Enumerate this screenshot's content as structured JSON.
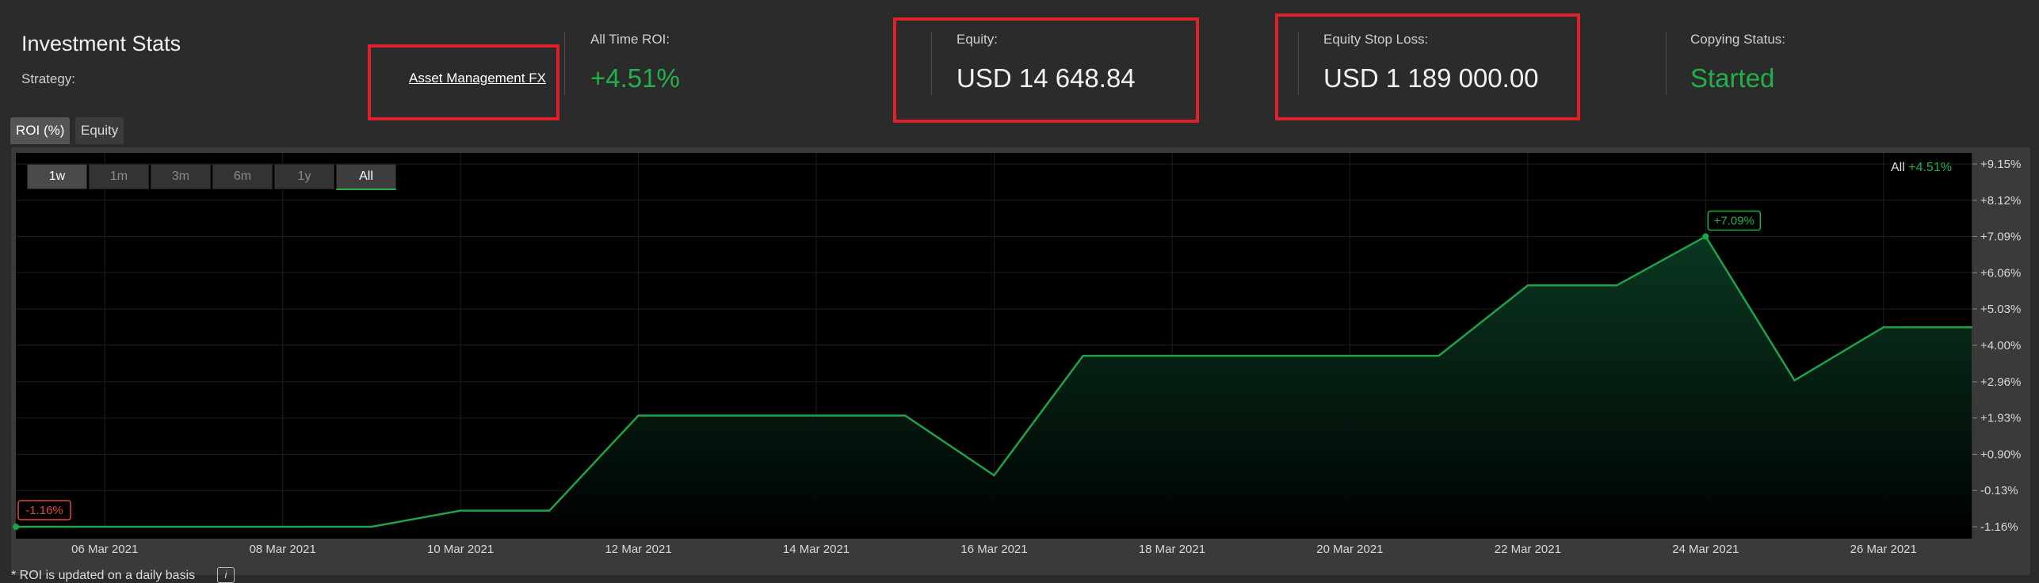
{
  "header": {
    "title": "Investment Stats",
    "strategy_label": "Strategy:",
    "strategy_link": "Asset Management FX"
  },
  "stats": {
    "roi_label": "All Time ROI:",
    "roi_value": "+4.51%",
    "equity_label": "Equity:",
    "equity_value": "USD 14 648.84",
    "stoploss_label": "Equity Stop Loss:",
    "stoploss_value": "USD 1 189 000.00",
    "copying_label": "Copying Status:",
    "copying_value": "Started"
  },
  "tabs": [
    {
      "label": "ROI (%)",
      "active": true
    },
    {
      "label": "Equity",
      "active": false
    }
  ],
  "periods": [
    {
      "label": "1w"
    },
    {
      "label": "1m"
    },
    {
      "label": "3m"
    },
    {
      "label": "6m"
    },
    {
      "label": "1y"
    },
    {
      "label": "All"
    }
  ],
  "legend": {
    "prefix": "All",
    "value": "+4.51%"
  },
  "footnote": "* ROI is updated on a daily basis",
  "info_icon": "i",
  "colors": {
    "accent_green": "#22b04b",
    "negative_red": "#e04a3a",
    "highlight_box": "#e0202a"
  },
  "chart_data": {
    "type": "area",
    "x_ticks": [
      "06 Mar 2021",
      "08 Mar 2021",
      "10 Mar 2021",
      "12 Mar 2021",
      "14 Mar 2021",
      "16 Mar 2021",
      "18 Mar 2021",
      "20 Mar 2021",
      "22 Mar 2021",
      "24 Mar 2021",
      "26 Mar 2021"
    ],
    "y_ticks": [
      "+9.15%",
      "+8.12%",
      "+7.09%",
      "+6.06%",
      "+5.03%",
      "+4.00%",
      "+2.96%",
      "+1.93%",
      "+0.90%",
      "-0.13%",
      "-1.16%"
    ],
    "ylim": [
      -1.16,
      9.15
    ],
    "x_range": [
      "05 Mar 2021",
      "27 Mar 2021"
    ],
    "points": [
      [
        "05 Mar 2021",
        -1.16
      ],
      [
        "09 Mar 2021",
        -1.16
      ],
      [
        "10 Mar 2021",
        -0.7
      ],
      [
        "11 Mar 2021",
        -0.7
      ],
      [
        "12 Mar 2021",
        2.0
      ],
      [
        "15 Mar 2021",
        2.0
      ],
      [
        "16 Mar 2021",
        0.3
      ],
      [
        "17 Mar 2021",
        3.7
      ],
      [
        "21 Mar 2021",
        3.7
      ],
      [
        "22 Mar 2021",
        5.7
      ],
      [
        "23 Mar 2021",
        5.7
      ],
      [
        "24 Mar 2021",
        7.09
      ],
      [
        "25 Mar 2021",
        3.0
      ],
      [
        "26 Mar 2021",
        4.51
      ],
      [
        "27 Mar 2021",
        4.51
      ]
    ],
    "annotations": [
      {
        "label": "-1.16%",
        "date": "05 Mar 2021",
        "value": -1.16,
        "kind": "min"
      },
      {
        "label": "+7.09%",
        "date": "24 Mar 2021",
        "value": 7.09,
        "kind": "max"
      }
    ],
    "grid": true,
    "legend_position": "top-right"
  }
}
